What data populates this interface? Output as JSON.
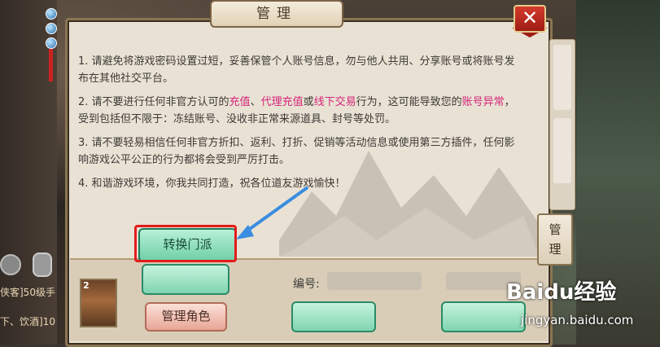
{
  "panel": {
    "title": "管理",
    "close_label": "✕",
    "rules": [
      {
        "parts": [
          {
            "t": "1. 请避免将游戏密码设置过短，妥善保管个人账号信息，勿与他人共用、分享账号或将账号发布在其他社交平台。",
            "hl": false
          }
        ]
      },
      {
        "parts": [
          {
            "t": "2. 请不要进行任何非官方认可的",
            "hl": false
          },
          {
            "t": "充值",
            "hl": true
          },
          {
            "t": "、",
            "hl": false
          },
          {
            "t": "代理充值",
            "hl": true
          },
          {
            "t": "或",
            "hl": false
          },
          {
            "t": "线下交易",
            "hl": true
          },
          {
            "t": "行为，这可能导致您的",
            "hl": false
          },
          {
            "t": "账号异常",
            "hl": true
          },
          {
            "t": "，受到包括但不限于：冻结账号、没收非正常来源道具、封号等处罚。",
            "hl": false
          }
        ]
      },
      {
        "parts": [
          {
            "t": "3. 请不要轻易相信任何非官方折扣、返利、打折、促销等活动信息或使用第三方插件，任何影响游戏公平公正的行为都将会受到严厉打击。",
            "hl": false
          }
        ]
      },
      {
        "parts": [
          {
            "t": "4. 和谐游戏环境，你我共同打造，祝各位道友游戏愉快！",
            "hl": false
          }
        ]
      }
    ],
    "side_tab_label": "管\n理",
    "buttons": {
      "switch_sect": "转换门派",
      "manage_role": "管理角色"
    },
    "id_label": "编号:",
    "avatar_level": "2"
  },
  "chat": {
    "line1": "侠客]50级手",
    "line2": "下、饮酒]10"
  },
  "colors": {
    "highlight_text": "#d6257a",
    "callout_box": "#e31b1b",
    "arrow": "#3a8de0"
  },
  "watermark": {
    "brand": "Baidu经验",
    "url": "jingyan.baidu.com"
  }
}
